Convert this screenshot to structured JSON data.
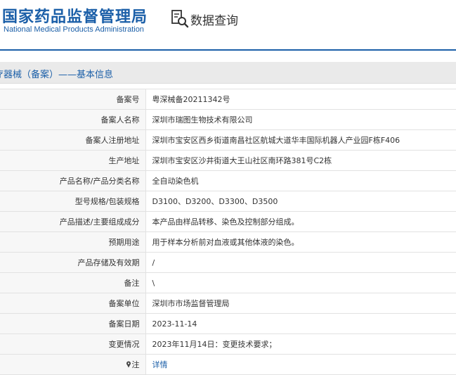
{
  "header": {
    "logo_cn": "国家药品监督管理局",
    "logo_en": "National Medical Products Administration",
    "query_label": "数据查询"
  },
  "section": {
    "title": "疗器械（备案）——基本信息"
  },
  "rows": [
    {
      "label": "备案号",
      "value": "粤深械备20211342号"
    },
    {
      "label": "备案人名称",
      "value": "深圳市瑞图生物技术有限公司"
    },
    {
      "label": "备案人注册地址",
      "value": "深圳市宝安区西乡街道南昌社区航城大道华丰国际机器人产业园F栋F406"
    },
    {
      "label": "生产地址",
      "value": "深圳市宝安区沙井街道大王山社区南环路381号C2栋"
    },
    {
      "label": "产品名称/产品分类名称",
      "value": "全自动染色机"
    },
    {
      "label": "型号规格/包装规格",
      "value": "D3100、D3200、D3300、D3500"
    },
    {
      "label": "产品描述/主要组成成分",
      "value": "本产品由样品转移、染色及控制部分组成。"
    },
    {
      "label": "预期用途",
      "value": "用于样本分析前对血液或其他体液的染色。"
    },
    {
      "label": "产品存储及有效期",
      "value": "/"
    },
    {
      "label": "备注",
      "value": "\\"
    },
    {
      "label": "备案单位",
      "value": "深圳市市场监督管理局"
    },
    {
      "label": "备案日期",
      "value": "2023-11-14"
    },
    {
      "label": "变更情况",
      "value": "2023年11月14日：变更技术要求；"
    }
  ],
  "note_row": {
    "label": "注",
    "link": "详情",
    "icon": "pin-icon"
  },
  "colors": {
    "brand": "#1b5fa8",
    "label_bg": "#f7f7f7",
    "section_bg": "#eaeaea"
  }
}
